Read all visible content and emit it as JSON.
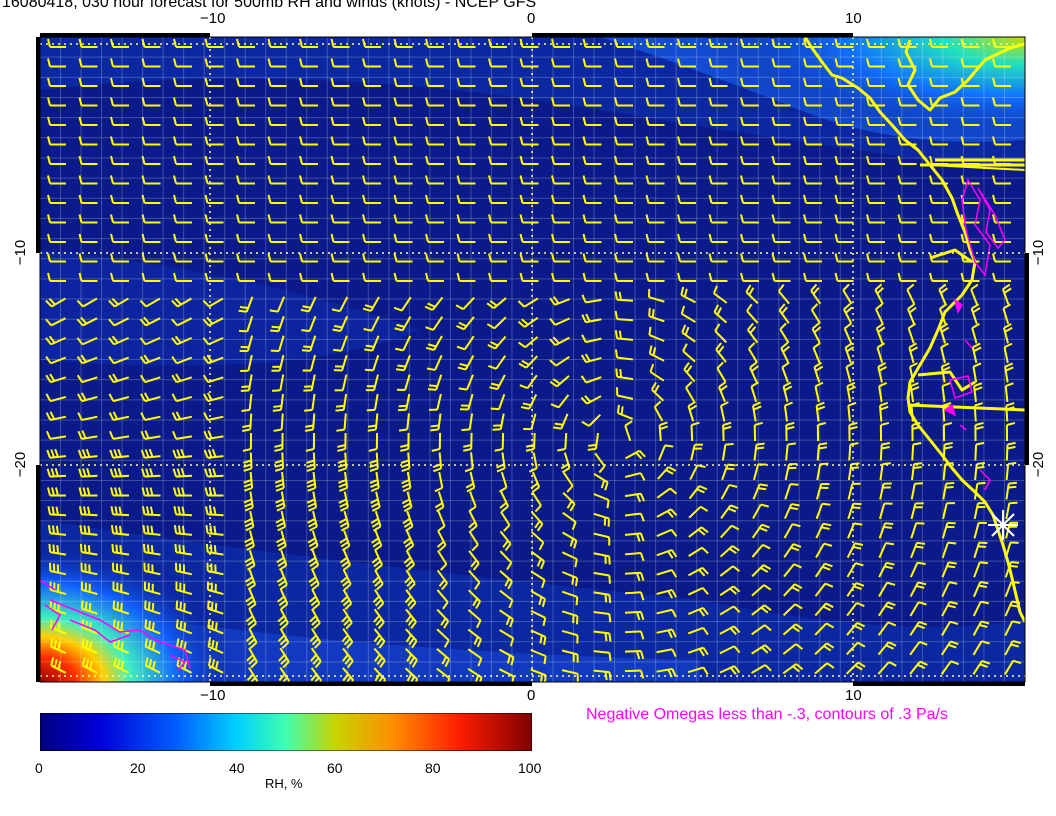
{
  "title": "16080418, 030 hour forecast for 500mb RH and winds (knots) - NCEP GFS",
  "note": "Negative Omegas less than -.3, contours of .3 Pa/s",
  "axes": {
    "x_ticks_top": [
      "−10",
      "0",
      "10"
    ],
    "x_ticks_bottom": [
      "−10",
      "0",
      "10"
    ],
    "y_ticks_left": [
      "−10",
      "−20"
    ],
    "y_ticks_right": [
      "−10",
      "−20"
    ]
  },
  "colorbar": {
    "title": "RH, %",
    "ticks": [
      "0",
      "20",
      "40",
      "60",
      "80",
      "100"
    ],
    "colors": [
      "#00007f",
      "#0000d8",
      "#0060ff",
      "#00d0ff",
      "#40ffb0",
      "#c8d400",
      "#ff8c00",
      "#ff1e00",
      "#7f0000"
    ]
  },
  "map": {
    "background_color": "#0a1a8a",
    "coast_color": "#ffff00",
    "contour_color": "#ff00ff",
    "wind_barb_color": "#ffff00",
    "marker": "star-marker"
  }
}
